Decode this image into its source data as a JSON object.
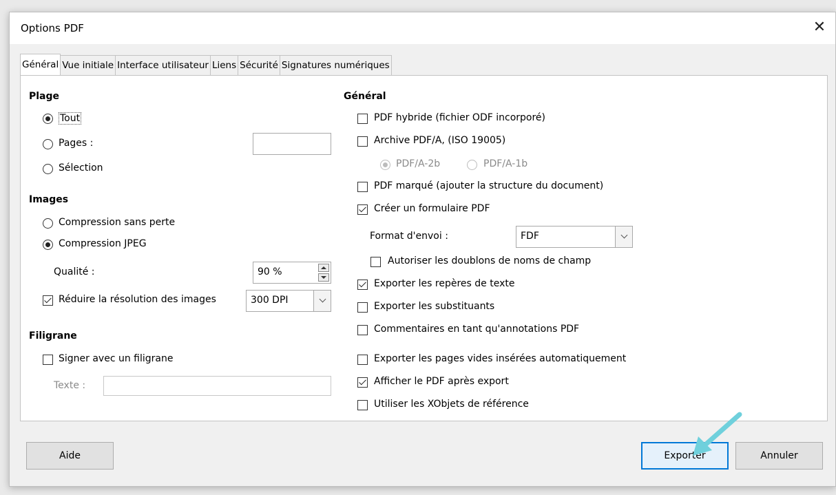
{
  "window": {
    "title": "Options PDF",
    "close_glyph": "✕"
  },
  "tabs": [
    {
      "label": "Général",
      "active": true
    },
    {
      "label": "Vue initiale",
      "active": false
    },
    {
      "label": "Interface utilisateur",
      "active": false
    },
    {
      "label": "Liens",
      "active": false
    },
    {
      "label": "Sécurité",
      "active": false
    },
    {
      "label": "Signatures numériques",
      "active": false
    }
  ],
  "range": {
    "heading": "Plage",
    "all": {
      "label": "Tout",
      "selected": true
    },
    "pages": {
      "label": "Pages :",
      "selected": false,
      "value": ""
    },
    "selection": {
      "label": "Sélection",
      "selected": false
    }
  },
  "images": {
    "heading": "Images",
    "lossless": {
      "label": "Compression sans perte",
      "selected": false
    },
    "jpeg": {
      "label": "Compression JPEG",
      "selected": true
    },
    "quality_label": "Qualité :",
    "quality_value": "90 %",
    "reduce": {
      "label": "Réduire la résolution des images",
      "checked": true
    },
    "dpi_value": "300 DPI"
  },
  "watermark": {
    "heading": "Filigrane",
    "sign": {
      "label": "Signer avec un filigrane",
      "checked": false
    },
    "text_label": "Texte :",
    "text_value": ""
  },
  "general": {
    "heading": "Général",
    "hybrid": {
      "label": "PDF hybride (fichier ODF incorporé)",
      "checked": false
    },
    "archive": {
      "label": "Archive PDF/A, (ISO 19005)",
      "checked": false
    },
    "pdfa2b": {
      "label": "PDF/A-2b",
      "selected": true
    },
    "pdfa1b": {
      "label": "PDF/A-1b",
      "selected": false
    },
    "tagged": {
      "label": "PDF marqué (ajouter la structure du document)",
      "checked": false
    },
    "form": {
      "label": "Créer un formulaire PDF",
      "checked": true
    },
    "submit_format_label": "Format d'envoi :",
    "submit_format_value": "FDF",
    "duplicates": {
      "label": "Autoriser les doublons de noms de champ",
      "checked": false
    },
    "bookmarks": {
      "label": "Exporter les repères de texte",
      "checked": true
    },
    "placeholders": {
      "label": "Exporter les substituants",
      "checked": false
    },
    "comments": {
      "label": "Commentaires en tant qu'annotations PDF",
      "checked": false
    },
    "blank_pages": {
      "label": "Exporter les pages vides insérées automatiquement",
      "checked": false
    },
    "view_after": {
      "label": "Afficher le PDF après export",
      "checked": true
    },
    "xobjects": {
      "label": "Utiliser les XObjets de référence",
      "checked": false
    }
  },
  "buttons": {
    "help": "Aide",
    "export": "Exporter",
    "cancel": "Annuler"
  },
  "colors": {
    "accent": "#0078d7",
    "annotation_arrow": "#6fd0dc"
  }
}
